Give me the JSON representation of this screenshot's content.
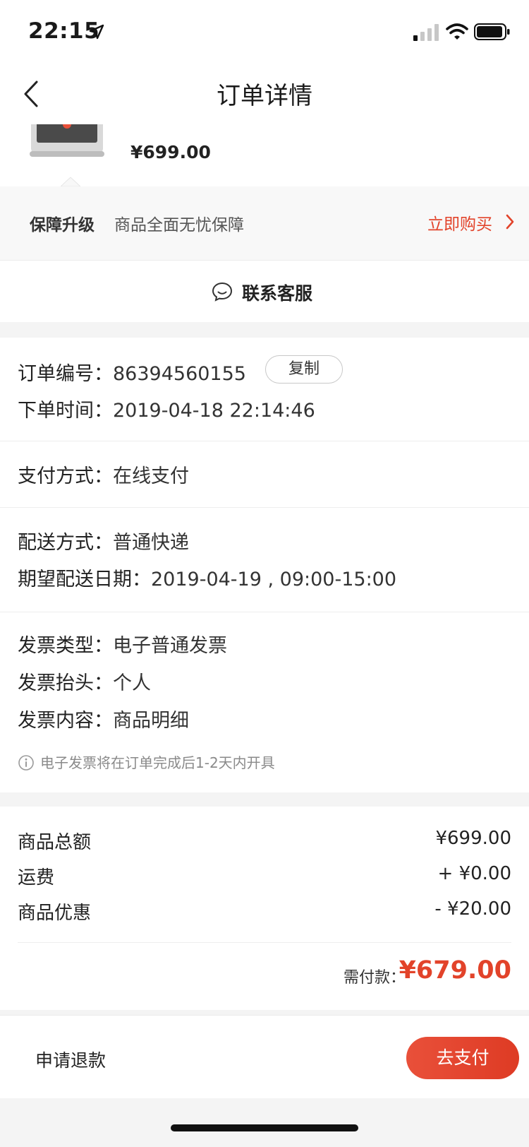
{
  "status_bar": {
    "time": "22:15"
  },
  "nav": {
    "title": "订单详情"
  },
  "product": {
    "price": "¥699.00"
  },
  "guarantee": {
    "title": "保障升级",
    "desc": "商品全面无忧保障",
    "buy_label": "立即购买"
  },
  "service": {
    "label": "联系客服"
  },
  "order": {
    "number_label": "订单编号：",
    "number": "86394560155",
    "copy_label": "复制",
    "time_label": "下单时间：",
    "time": "2019-04-18 22:14:46",
    "payment_label": "支付方式：",
    "payment": "在线支付",
    "delivery_label": "配送方式：",
    "delivery": "普通快递",
    "expected_label": "期望配送日期：",
    "expected": "2019-04-19 , 09:00-15:00",
    "invoice_type_label": "发票类型：",
    "invoice_type": "电子普通发票",
    "invoice_title_label": "发票抬头：",
    "invoice_title": "个人",
    "invoice_content_label": "发票内容：",
    "invoice_content": "商品明细",
    "invoice_note": "电子发票将在订单完成后1-2天内开具"
  },
  "summary": {
    "total_label": "商品总额",
    "total": "¥699.00",
    "shipping_label": "运费",
    "shipping": "+ ¥0.00",
    "discount_label": "商品优惠",
    "discount": "- ¥20.00",
    "pay_label": "需付款：",
    "pay_total": "¥679.00"
  },
  "actions": {
    "refund": "申请退款",
    "pay": "去支付"
  },
  "colors": {
    "accent": "#e2432a",
    "background": "#f4f4f4"
  }
}
